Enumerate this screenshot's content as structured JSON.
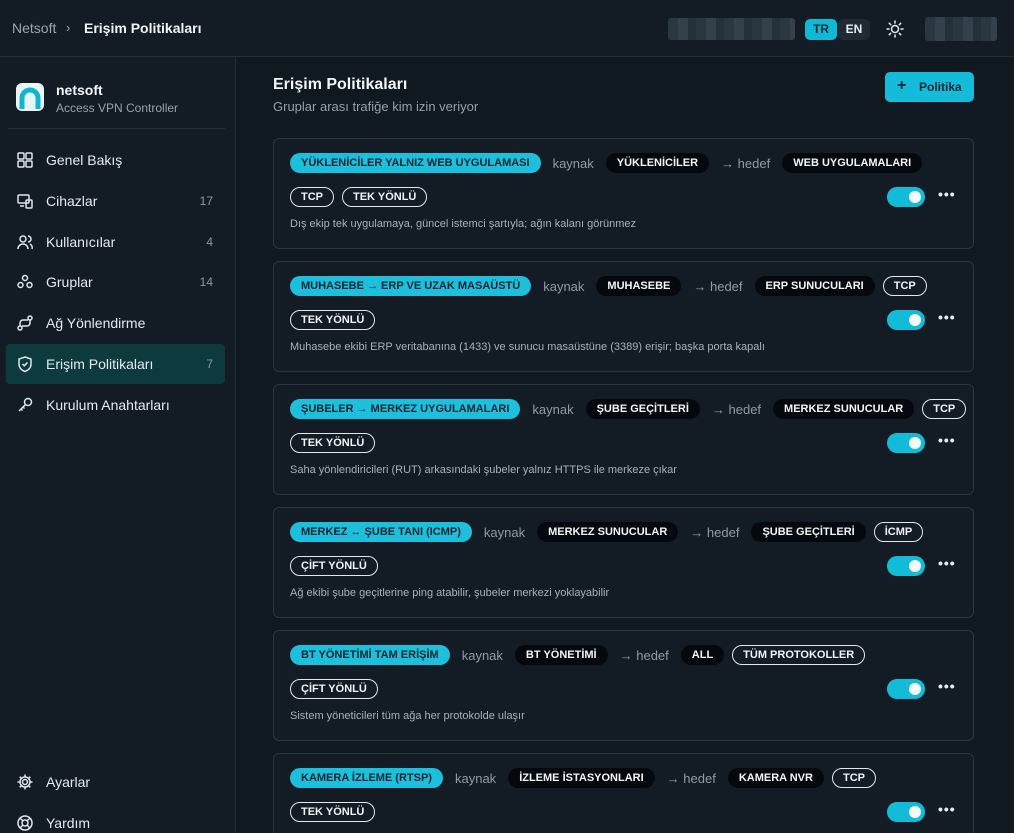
{
  "header": {
    "breadcrumb_root": "Netsoft",
    "breadcrumb_sep": "›",
    "breadcrumb_current": "Erişim Politikaları",
    "lang_tr": "TR",
    "lang_en": "EN",
    "theme_icon": "sun-icon"
  },
  "brand": {
    "name": "netsoft",
    "subtitle": "Access VPN Controller"
  },
  "nav": {
    "items": [
      {
        "label": "Genel Bakış",
        "count": "",
        "icon": "grid-icon"
      },
      {
        "label": "Cihazlar",
        "count": "17",
        "icon": "devices-icon"
      },
      {
        "label": "Kullanıcılar",
        "count": "4",
        "icon": "user-icon"
      },
      {
        "label": "Gruplar",
        "count": "14",
        "icon": "group-icon"
      },
      {
        "label": "Ağ Yönlendirme",
        "count": "",
        "icon": "route-icon"
      },
      {
        "label": "Erişim Politikaları",
        "count": "7",
        "icon": "shield-icon"
      },
      {
        "label": "Kurulum Anahtarları",
        "count": "",
        "icon": "key-icon"
      }
    ],
    "bottom": [
      {
        "label": "Ayarlar",
        "icon": "gear-icon"
      },
      {
        "label": "Yardım",
        "icon": "help-icon"
      }
    ]
  },
  "page": {
    "title": "Erişim Politikaları",
    "subtitle": "Gruplar arası trafiğe kim izin veriyor",
    "add_button": "Politika",
    "add_icon": "+"
  },
  "labels": {
    "source": "kaynak",
    "target": "→ hedef",
    "more": "•••"
  },
  "colors": {
    "accent": "#14bcd9",
    "active_nav": "#0d3a3d",
    "background": "#101820"
  },
  "policies": [
    {
      "name": "YÜKLENİCİLER YALNIZ WEB UYGULAMASI",
      "source": "YÜKLENİCİLER",
      "target": "WEB UYGULAMALARI",
      "protocol": "TCP",
      "direction": "TEK YÖNLÜ",
      "enabled": true,
      "description": "Dış ekip tek uygulamaya, güncel istemci şartıyla; ağın kalanı görünmez"
    },
    {
      "name": "MUHASEBE → ERP VE UZAK MASAÜSTÜ",
      "source": "MUHASEBE",
      "target": "ERP SUNUCULARI",
      "protocol": "TCP",
      "direction": "TEK YÖNLÜ",
      "enabled": true,
      "description": "Muhasebe ekibi ERP veritabanına (1433) ve sunucu masaüstüne (3389) erişir; başka porta kapalı"
    },
    {
      "name": "ŞUBELER → MERKEZ UYGULAMALARI",
      "source": "ŞUBE GEÇİTLERİ",
      "target": "MERKEZ SUNUCULAR",
      "protocol": "TCP",
      "direction": "TEK YÖNLÜ",
      "enabled": true,
      "description": "Saha yönlendiricileri (RUT) arkasındaki şubeler yalnız HTTPS ile merkeze çıkar"
    },
    {
      "name": "MERKEZ ↔ ŞUBE TANI (ICMP)",
      "source": "MERKEZ SUNUCULAR",
      "target": "ŞUBE GEÇİTLERİ",
      "protocol": "İCMP",
      "direction": "ÇİFT YÖNLÜ",
      "enabled": true,
      "description": "Ağ ekibi şube geçitlerine ping atabilir, şubeler merkezi yoklayabilir"
    },
    {
      "name": "BT YÖNETİMİ TAM ERİŞİM",
      "source": "BT YÖNETİMİ",
      "target": "ALL",
      "protocol": "TÜM PROTOKOLLER",
      "direction": "ÇİFT YÖNLÜ",
      "enabled": true,
      "description": "Sistem yöneticileri tüm ağa her protokolde ulaşır"
    },
    {
      "name": "KAMERA İZLEME (RTSP)",
      "source": "İZLEME İSTASYONLARI",
      "target": "KAMERA NVR",
      "protocol": "TCP",
      "direction": "TEK YÖNLÜ",
      "enabled": true,
      "description": ""
    }
  ]
}
